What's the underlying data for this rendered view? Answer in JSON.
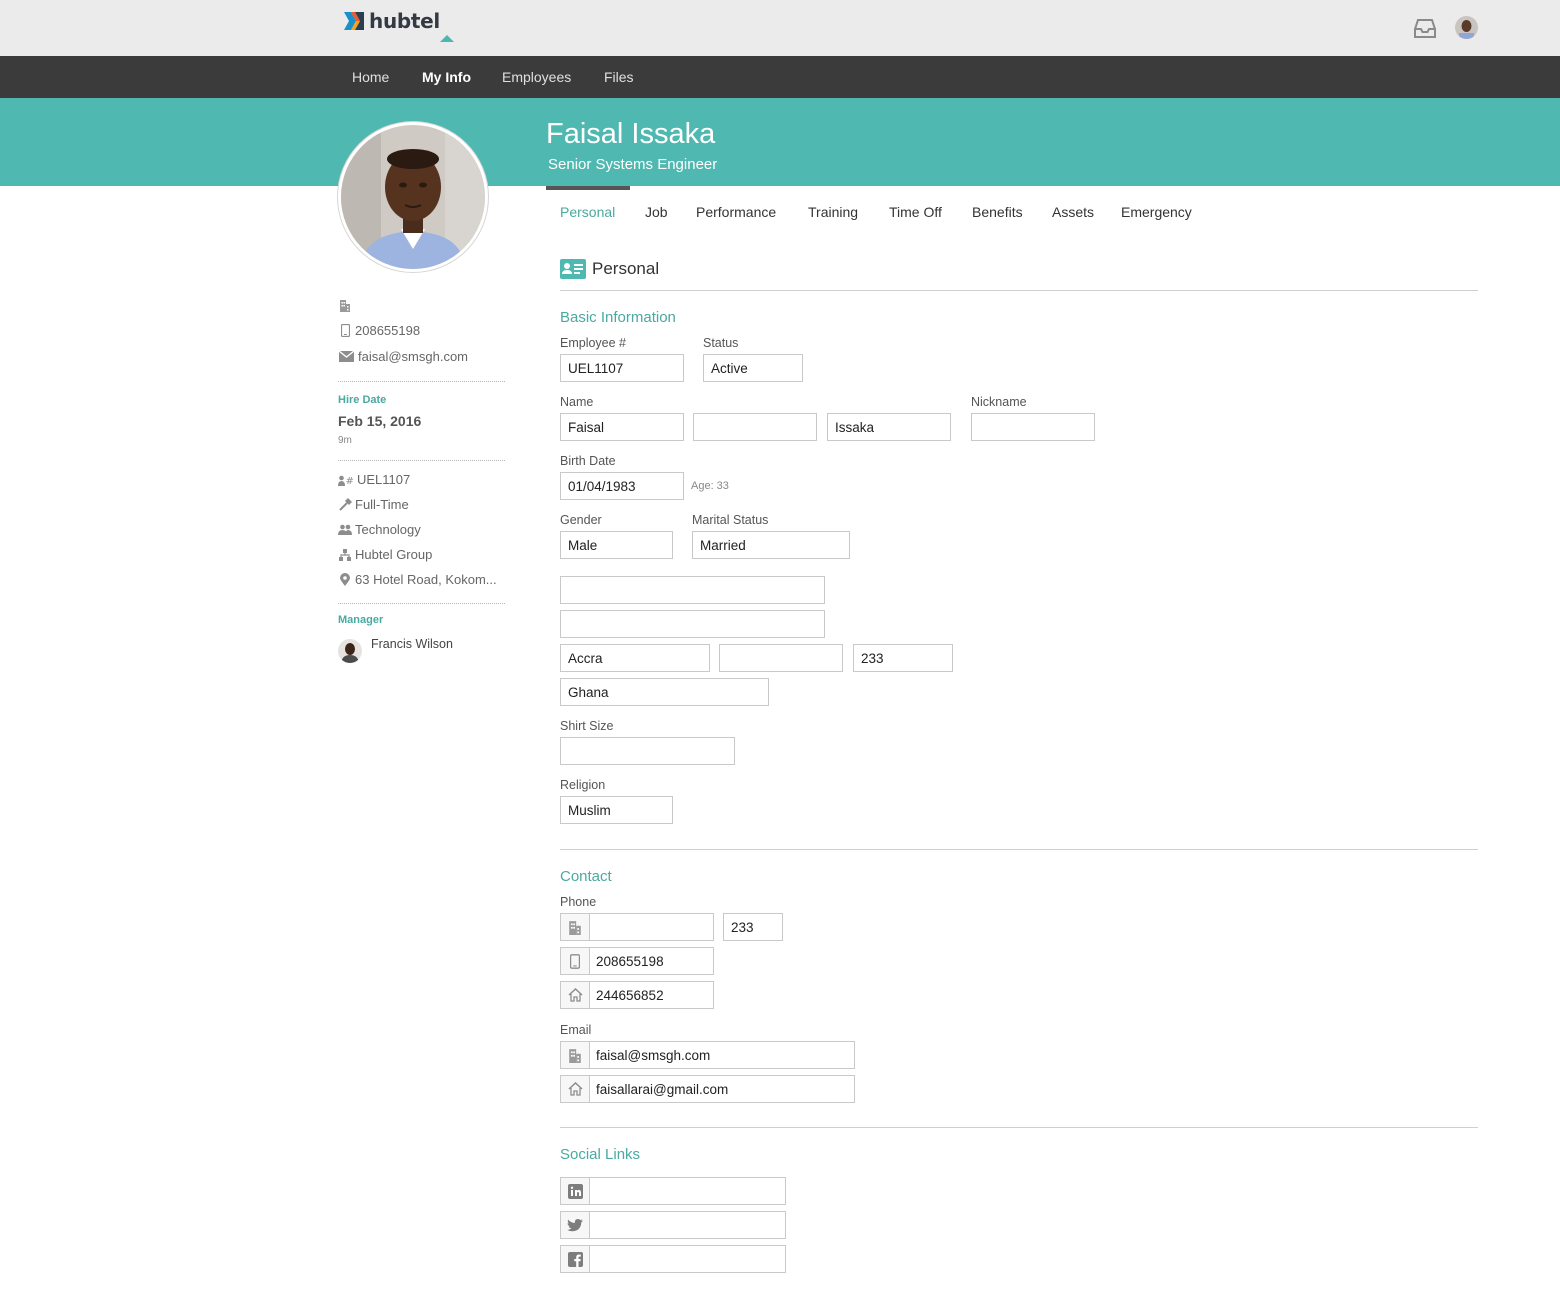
{
  "brand": {
    "name": "hubtel"
  },
  "nav": {
    "items": [
      {
        "label": "Home"
      },
      {
        "label": "My Info"
      },
      {
        "label": "Employees"
      },
      {
        "label": "Files"
      }
    ]
  },
  "employee": {
    "name": "Faisal Issaka",
    "title": "Senior Systems Engineer"
  },
  "sidebar": {
    "mobile": "208655198",
    "email": "faisal@smsgh.com",
    "hire_date_label": "Hire Date",
    "hire_date": "Feb 15, 2016",
    "tenure": "9m",
    "employee_id": "UEL1107",
    "employment_type": "Full-Time",
    "department": "Technology",
    "division": "Hubtel Group",
    "location": "63 Hotel Road, Kokom...",
    "manager_label": "Manager",
    "manager_name": "Francis Wilson"
  },
  "tabs": [
    {
      "label": "Personal"
    },
    {
      "label": "Job"
    },
    {
      "label": "Performance"
    },
    {
      "label": "Training"
    },
    {
      "label": "Time Off"
    },
    {
      "label": "Benefits"
    },
    {
      "label": "Assets"
    },
    {
      "label": "Emergency"
    }
  ],
  "personal": {
    "heading": "Personal",
    "basic_info": {
      "heading": "Basic Information",
      "employee_no_label": "Employee #",
      "employee_no": "UEL1107",
      "status_label": "Status",
      "status": "Active",
      "name_label": "Name",
      "first_name": "Faisal",
      "middle_name": "",
      "last_name": "Issaka",
      "nickname_label": "Nickname",
      "nickname": "",
      "birth_date_label": "Birth Date",
      "birth_date": "01/04/1983",
      "age_text": "Age: 33",
      "gender_label": "Gender",
      "gender": "Male",
      "marital_label": "Marital Status",
      "marital": "Married",
      "address1": "",
      "address2": "",
      "city": "Accra",
      "state": "",
      "postal": "233",
      "country": "Ghana",
      "shirt_label": "Shirt Size",
      "shirt": "",
      "religion_label": "Religion",
      "religion": "Muslim"
    },
    "contact": {
      "heading": "Contact",
      "phone_label": "Phone",
      "work_phone": "",
      "work_ext": "233",
      "mobile_phone": "208655198",
      "home_phone": "244656852",
      "email_label": "Email",
      "work_email": "faisal@smsgh.com",
      "home_email": "faisallarai@gmail.com"
    },
    "social": {
      "heading": "Social Links",
      "linkedin": "",
      "twitter": "",
      "facebook": ""
    }
  },
  "colors": {
    "accent": "#4fb8b0",
    "nav_bg": "#3b3b3b",
    "header_bg": "#ebebeb"
  }
}
